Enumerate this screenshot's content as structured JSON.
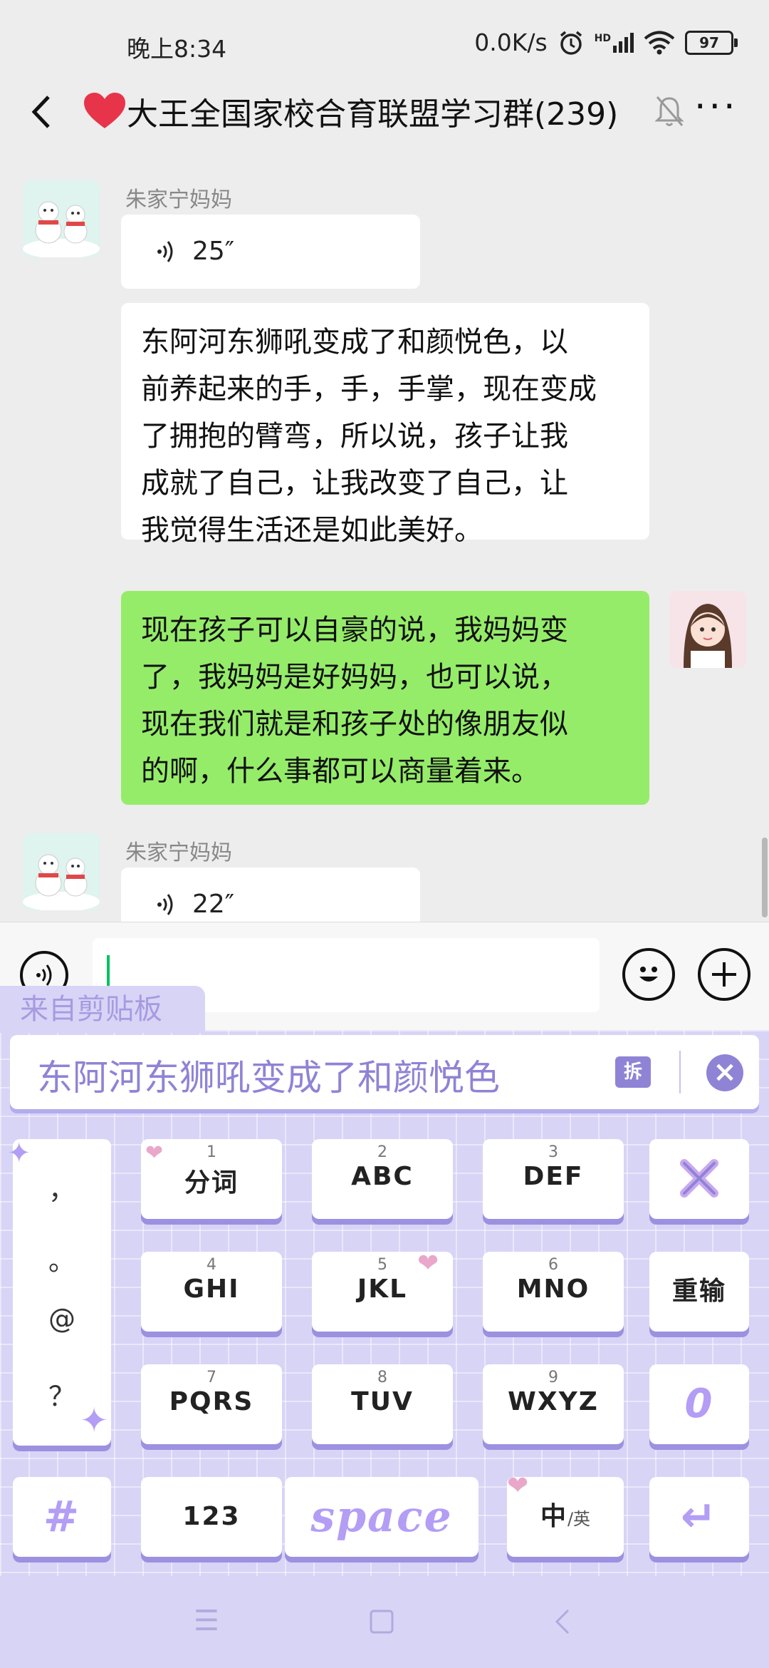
{
  "status_bar": {
    "time": "晚上8:34",
    "net_speed": "0.0K/s",
    "signal_label": "HD",
    "battery": "97"
  },
  "header": {
    "back_label": "<",
    "title": "大王全国家校合育联盟学习群(239)",
    "more_label": "···"
  },
  "messages": [
    {
      "sender": "朱家宁妈妈",
      "type": "voice",
      "duration": "25″"
    },
    {
      "sender": "",
      "type": "text",
      "lines": [
        "东阿河东狮吼变成了和颜悦色，以",
        "前养起来的手，手，手掌，现在变成",
        "了拥抱的臂弯，所以说，孩子让我",
        "成就了自己，让我改变了自己，让",
        "我觉得生活还是如此美好。"
      ]
    },
    {
      "sender": "me",
      "type": "text",
      "lines": [
        "现在孩子可以自豪的说，我妈妈变",
        "了，我妈妈是好妈妈，也可以说，",
        "现在我们就是和孩子处的像朋友似",
        "的啊，什么事都可以商量着来。"
      ]
    },
    {
      "sender": "朱家宁妈妈",
      "type": "voice",
      "duration": "22″"
    }
  ],
  "input": {
    "value": ""
  },
  "keyboard": {
    "clipboard_tab": "来自剪贴板",
    "clipboard_text": "东阿河东狮吼变成了和颜悦色",
    "split_label": "拆",
    "symbols": [
      "，",
      "。",
      "@",
      "？"
    ],
    "keys": [
      {
        "num": "1",
        "label": "分词"
      },
      {
        "num": "2",
        "label": "ABC"
      },
      {
        "num": "3",
        "label": "DEF"
      },
      {
        "num": "4",
        "label": "GHI"
      },
      {
        "num": "5",
        "label": "JKL"
      },
      {
        "num": "6",
        "label": "MNO"
      },
      {
        "num": "7",
        "label": "PQRS"
      },
      {
        "num": "8",
        "label": "TUV"
      },
      {
        "num": "9",
        "label": "WXYZ"
      }
    ],
    "retype_label": "重输",
    "zero_label": "0",
    "hash_label": "#",
    "num_label": "123",
    "space_label": "space",
    "lang_main": "中",
    "lang_alt": "/英",
    "enter_label": "↵"
  },
  "colors": {
    "green_bubble": "#95ec69",
    "keyboard_bg": "#d8d4f6",
    "accent_purple": "#8f83d6"
  }
}
